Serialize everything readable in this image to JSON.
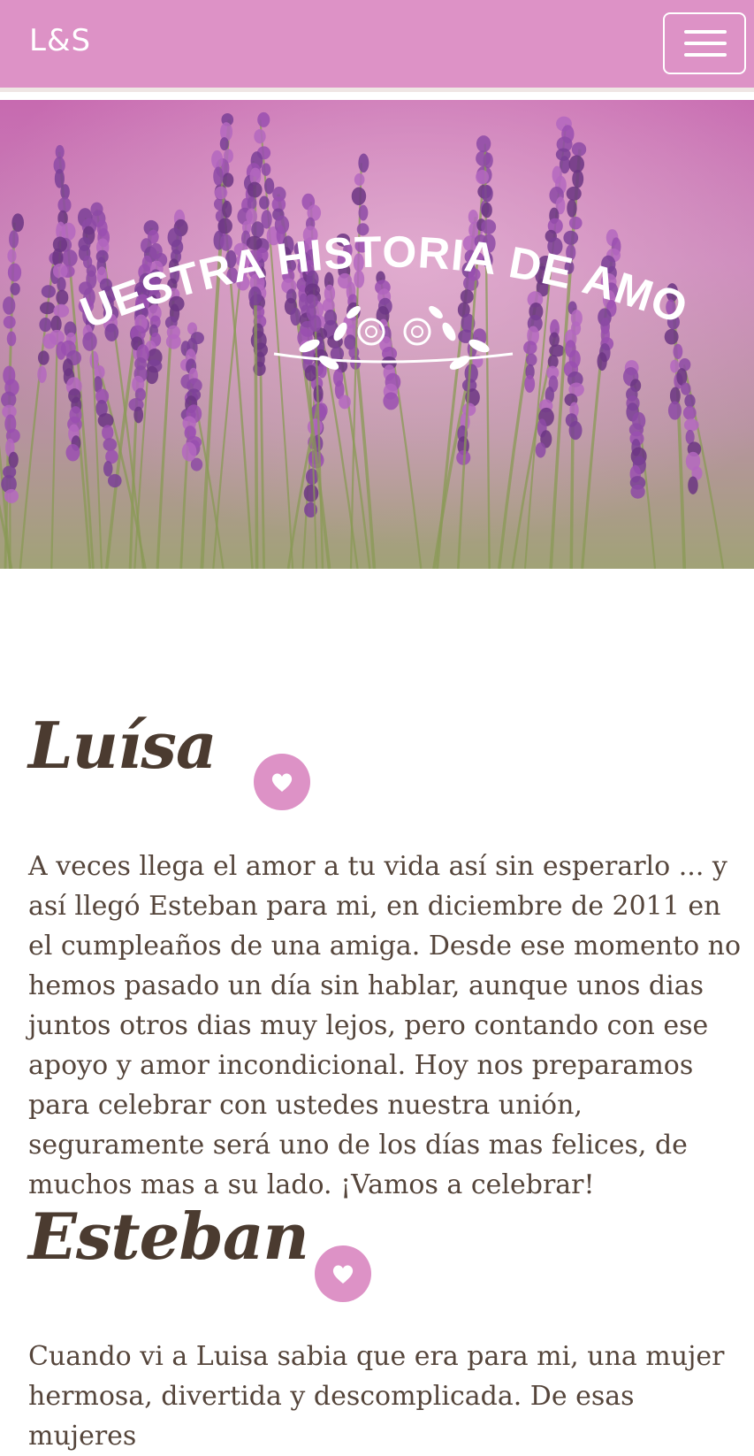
{
  "navbar": {
    "brand": "L&S",
    "menu_icon": "hamburger-menu-icon",
    "background_color": "#dd92c6"
  },
  "hero": {
    "title": "NUESTRA HISTORIA DE AMOR",
    "ornament_icon": "floral-ornament-icon"
  },
  "sections": [
    {
      "name": "Luísa",
      "badge_icon": "heart-icon",
      "text": "A veces llega el amor a tu vida así sin esperarlo ... y así llegó Esteban para mi, en diciembre de 2011 en el cumpleaños de una amiga. Desde ese momento no hemos pasado un día sin hablar, aunque unos dias juntos otros dias muy lejos, pero contando con ese apoyo y amor incondicional. Hoy nos preparamos para celebrar con ustedes nuestra unión, seguramente será uno de los días mas felices, de muchos mas a su lado. ¡Vamos a celebrar!"
    },
    {
      "name": "Esteban",
      "badge_icon": "heart-icon",
      "text": "Cuando vi a Luisa sabia que era para mi, una mujer hermosa, divertida y descomplicada. De esas mujeres"
    }
  ],
  "colors": {
    "accent": "#dd92c6",
    "heading": "#4b3b30",
    "body_text": "#55453b"
  }
}
